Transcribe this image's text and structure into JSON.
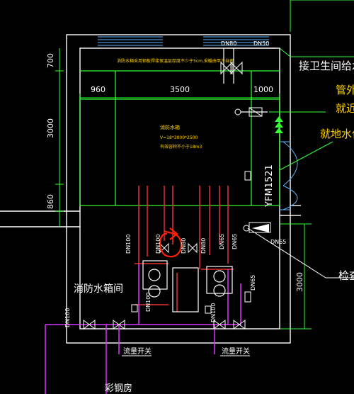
{
  "drawing": {
    "note_top": "消防水箱采用钢板焊接保温层厚度不少于5cm,采暖由甲方自理",
    "tank": {
      "title": "消防水箱",
      "spec_size": "V=18*3000*2500",
      "spec_capacity": "有效容积不小于18m3"
    },
    "dims_top": [
      "960",
      "3500",
      "1000"
    ],
    "dims_left": [
      "700",
      "3000",
      "860"
    ],
    "dim_right": "3000",
    "room_label": "消防水箱间",
    "door_label": "YFM1521",
    "flow_switch_1": "流量开关",
    "flow_switch_2": "流量开关",
    "bottom_label": "彩钢房",
    "pipe_labels": {
      "dn50_top": "DN50",
      "dn80_top": "DN80",
      "dn100_a": "DN100",
      "dn100_b": "DN100",
      "dn80_mid_a": "DN80",
      "dn80_mid_b": "DN80",
      "dn65_a": "DN65",
      "dn65_b": "DN65",
      "dn65_c": "DN65",
      "dn100_c": "DN100",
      "dn100_d": "DN100",
      "dn100_e": "DN100",
      "dn65_right": "DN65"
    },
    "callouts": {
      "c1": "接卫生间给水",
      "c2a": "管外",
      "c2b": "就近",
      "c3": "就地水位",
      "c4": "检查"
    },
    "colors": {
      "walls": "#ffffff",
      "dims": "#33ff33",
      "pipes_red": "#e83030",
      "pipes_magenta": "#dd33ff",
      "text_yellow": "#ffd200",
      "door_cyan": "#5ab4ff",
      "markup": "#ff2200"
    }
  }
}
